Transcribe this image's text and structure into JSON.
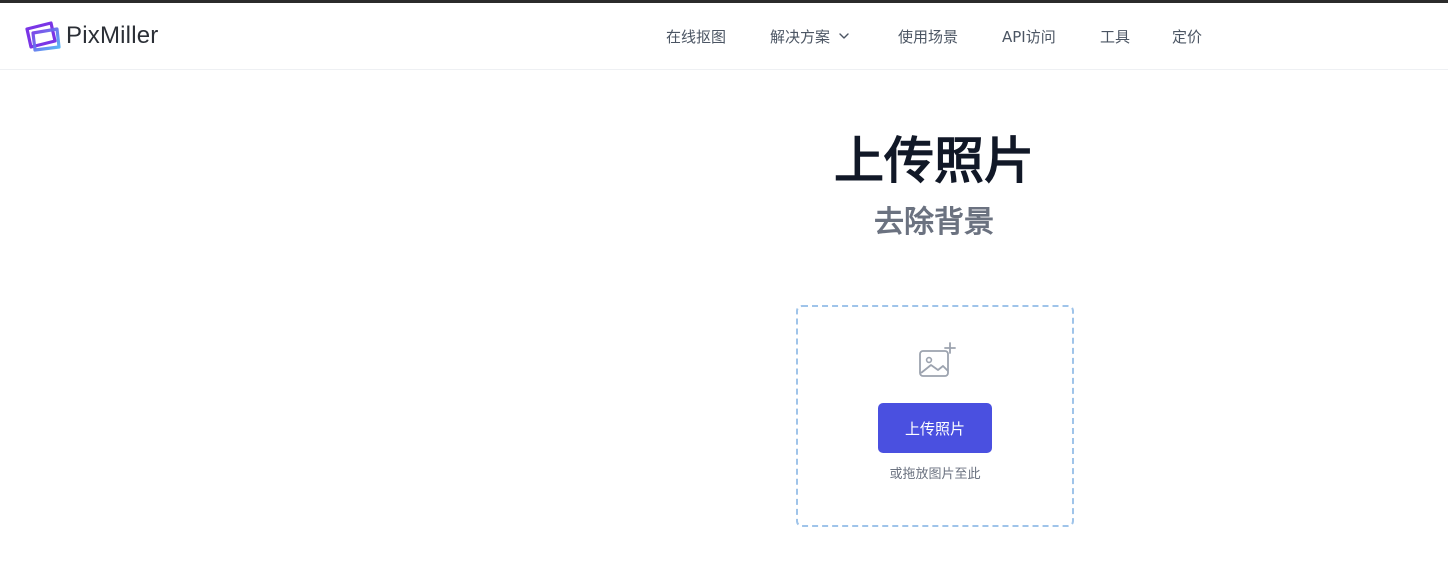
{
  "brand": {
    "name": "PixMiller",
    "logo_colors": [
      "#6b3fe0",
      "#4fc3f7"
    ]
  },
  "nav": {
    "items": [
      {
        "label": "在线抠图"
      },
      {
        "label": "解决方案",
        "icon": "chevron-down-icon"
      },
      {
        "label": "使用场景"
      },
      {
        "label": "API访问"
      },
      {
        "label": "工具"
      },
      {
        "label": "定价"
      }
    ]
  },
  "hero": {
    "title": "上传照片",
    "subtitle": "去除背景"
  },
  "upload": {
    "icon": "add-image-icon",
    "button_label": "上传照片",
    "hint": "或拖放图片至此",
    "button_color": "#4a50e0",
    "border_color": "#9fc4ea"
  }
}
